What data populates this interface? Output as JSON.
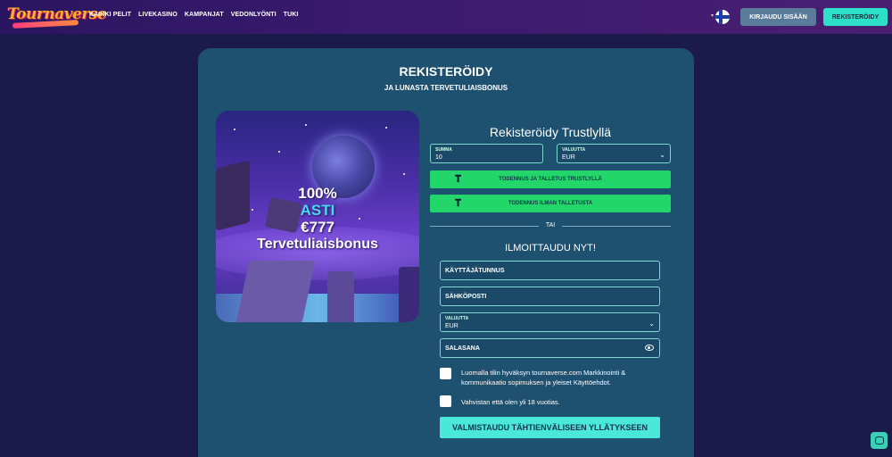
{
  "header": {
    "logo_text": "Tournaverse",
    "nav": [
      "KAIKKI PELIT",
      "LIVEKASINO",
      "KAMPANJAT",
      "VEDONLYÖNTI",
      "TUKI"
    ],
    "login_label": "KIRJAUDU SISÄÄN",
    "register_label": "REKISTERÖIDY",
    "language_icon": "finland-flag-icon"
  },
  "card": {
    "title": "REKISTERÖIDY",
    "subtitle": "JA LUNASTA TERVETULIAISBONUS"
  },
  "promo": {
    "line1": "100%",
    "line2": "ASTI",
    "line3": "€777",
    "line4": "Tervetuliaisbonus"
  },
  "trustly": {
    "title": "Rekisteröidy Trustlyllä",
    "amount_label": "SUMMA",
    "amount_value": "10",
    "currency_label": "VALUUTTA",
    "currency_value": "EUR",
    "deposit_button": "TODENNUS JA TALLETUS TRUSTLYLLÄ",
    "verify_button": "TODENNUS ILMAN TALLETUSTA",
    "or_text": "TAI"
  },
  "signup": {
    "title": "ILMOITTAUDU NYT!",
    "username_placeholder": "KÄYTTÄJÄTUNNUS",
    "email_placeholder": "SÄHKÖPOSTI",
    "currency_label": "VALUUTTA",
    "currency_value": "EUR",
    "password_placeholder": "SALASANA",
    "terms_text": "Luomalla tilin hyväksyn tournaverse.com Markkinointi & kommunikaatio sopimuksen ja yleiset Käyttöehdot.",
    "age_text": "Vahvistan että olen yli 18 vuotias.",
    "submit_label": "VALMISTAUDU TÄHTIENVÄLISEEN YLLÄTYKSEEN"
  },
  "colors": {
    "background": "#1c1a4a",
    "card": "#1e5070",
    "accent_teal": "#2de0c8",
    "trustly_green": "#22d66a"
  }
}
